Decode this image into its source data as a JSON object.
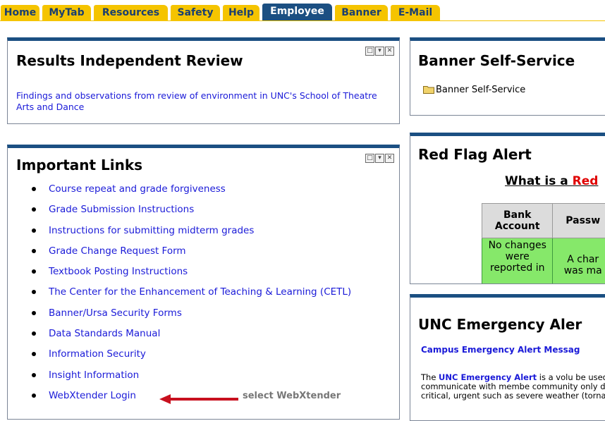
{
  "tabs": [
    {
      "label": "Home",
      "active": false
    },
    {
      "label": "MyTab",
      "active": false
    },
    {
      "label": "Resources",
      "active": false
    },
    {
      "label": "Safety",
      "active": false
    },
    {
      "label": "Help",
      "active": false
    },
    {
      "label": "Employee",
      "active": true
    },
    {
      "label": "Banner",
      "active": false
    },
    {
      "label": "E-Mail",
      "active": false
    }
  ],
  "results_portlet": {
    "title": "Results Independent Review",
    "description": "Findings and observations from review of environment in UNC's School of Theatre Arts and Dance"
  },
  "links_portlet": {
    "title": "Important Links",
    "items": [
      "Course repeat and grade forgiveness",
      "Grade Submission Instructions",
      "Instructions for submitting midterm grades",
      "Grade Change Request Form",
      "Textbook Posting Instructions",
      "The Center for the Enhancement of Teaching & Learning (CETL)",
      "Banner/Ursa Security Forms",
      "Data Standards Manual",
      "Information Security",
      "Insight Information",
      "WebXtender Login"
    ]
  },
  "annotation": {
    "text": "select WebXtender",
    "color": "#c8101e"
  },
  "banner_portlet": {
    "title": "Banner Self-Service",
    "link": "Banner Self-Service"
  },
  "redflag_portlet": {
    "title": "Red Flag Alert",
    "question_prefix": "What is a ",
    "question_red": "Red",
    "table_headers": [
      "Bank Account",
      "Passw"
    ],
    "table_cells": [
      "No changes were reported in",
      "A char was ma"
    ]
  },
  "emergency_portlet": {
    "title": "UNC Emergency Aler",
    "subhead": "Campus Emergency Alert Messag",
    "body_prefix": "The ",
    "body_bold": "UNC Emergency Alert",
    "body_rest": " is a volu be used to communicate with membe community only during critical, urgent such as severe weather (tornado war"
  },
  "colors": {
    "tab_bg": "#f5c400",
    "tab_active_bg": "#1b4f82",
    "portlet_header": "#1b4f82",
    "link": "#1a1ad8",
    "alert_green": "#86e86a"
  }
}
